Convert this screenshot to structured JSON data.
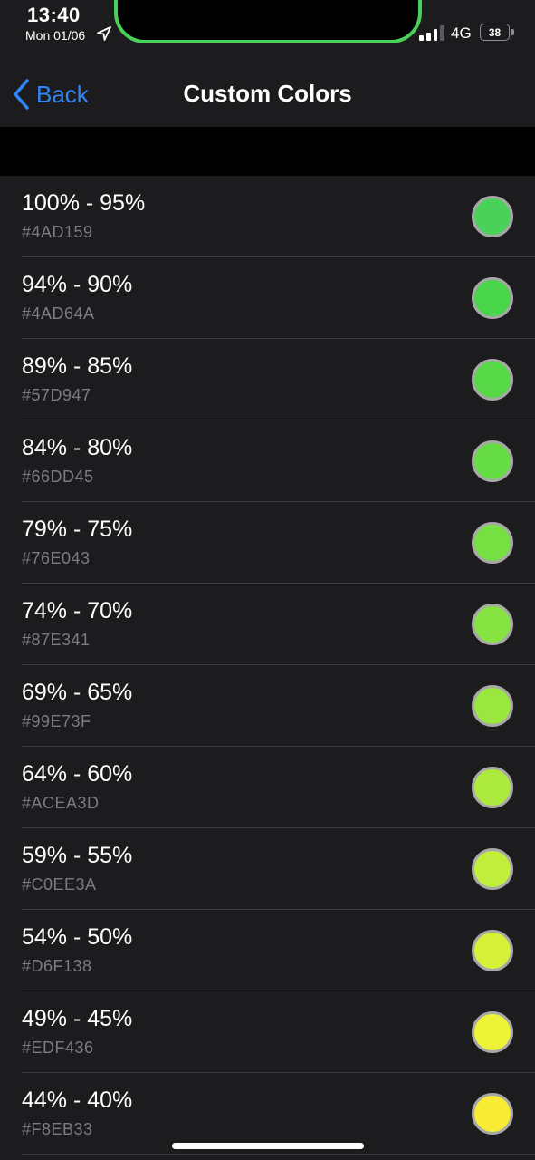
{
  "status_bar": {
    "time": "13:40",
    "date": "Mon 01/06",
    "network": "4G",
    "battery_level": "38",
    "notch_color": "#4AD159",
    "icons": [
      "location-arrow-icon",
      "signal-bars-icon",
      "battery-icon"
    ]
  },
  "nav": {
    "back_label": "Back",
    "title": "Custom Colors",
    "accent_color": "#2F86F6"
  },
  "colors": [
    {
      "range": "100% - 95%",
      "hex": "#4AD159"
    },
    {
      "range": "94% - 90%",
      "hex": "#4AD64A"
    },
    {
      "range": "89% - 85%",
      "hex": "#57D947"
    },
    {
      "range": "84% - 80%",
      "hex": "#66DD45"
    },
    {
      "range": "79% - 75%",
      "hex": "#76E043"
    },
    {
      "range": "74% - 70%",
      "hex": "#87E341"
    },
    {
      "range": "69% - 65%",
      "hex": "#99E73F"
    },
    {
      "range": "64% - 60%",
      "hex": "#ACEA3D"
    },
    {
      "range": "59% - 55%",
      "hex": "#C0EE3A"
    },
    {
      "range": "54% - 50%",
      "hex": "#D6F138"
    },
    {
      "range": "49% - 45%",
      "hex": "#EDF436"
    },
    {
      "range": "44% - 40%",
      "hex": "#F8EB33"
    }
  ]
}
